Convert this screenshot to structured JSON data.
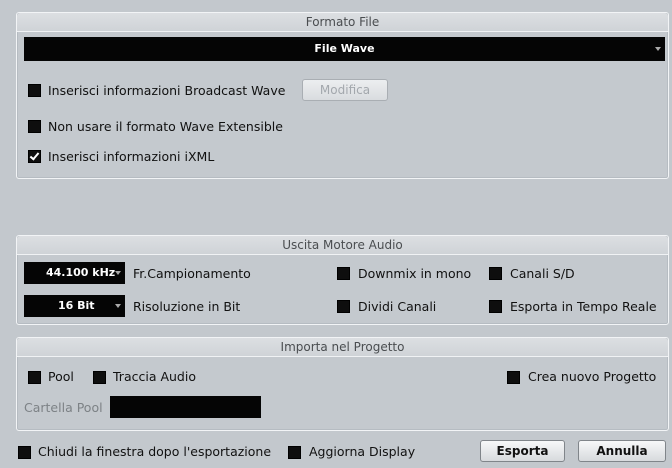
{
  "format_panel": {
    "title": "Formato File",
    "file_type": "File Wave",
    "broadcast_label": "Inserisci informazioni Broadcast Wave",
    "broadcast_checked": false,
    "modify_button": "Modifica",
    "no_extensible_label": "Non usare il formato Wave Extensible",
    "no_extensible_checked": false,
    "ixml_label": "Inserisci informazioni iXML",
    "ixml_checked": true
  },
  "audio_panel": {
    "title": "Uscita Motore Audio",
    "sample_rate_value": "44.100 kHz",
    "sample_rate_label": "Fr.Campionamento",
    "bit_depth_value": "16 Bit",
    "bit_depth_label": "Risoluzione in Bit",
    "downmix_label": "Downmix in mono",
    "split_channels_label": "Dividi Canali",
    "lr_channels_label": "Canali S/D",
    "realtime_label": "Esporta in Tempo Reale"
  },
  "import_panel": {
    "title": "Importa nel Progetto",
    "pool_label": "Pool",
    "audio_track_label": "Traccia Audio",
    "new_project_label": "Crea nuovo Progetto",
    "pool_folder_label": "Cartella Pool",
    "pool_folder_value": ""
  },
  "footer": {
    "close_after_label": "Chiudi la finestra dopo l'esportazione",
    "update_display_label": "Aggiorna Display",
    "export_button": "Esporta",
    "cancel_button": "Annulla"
  }
}
